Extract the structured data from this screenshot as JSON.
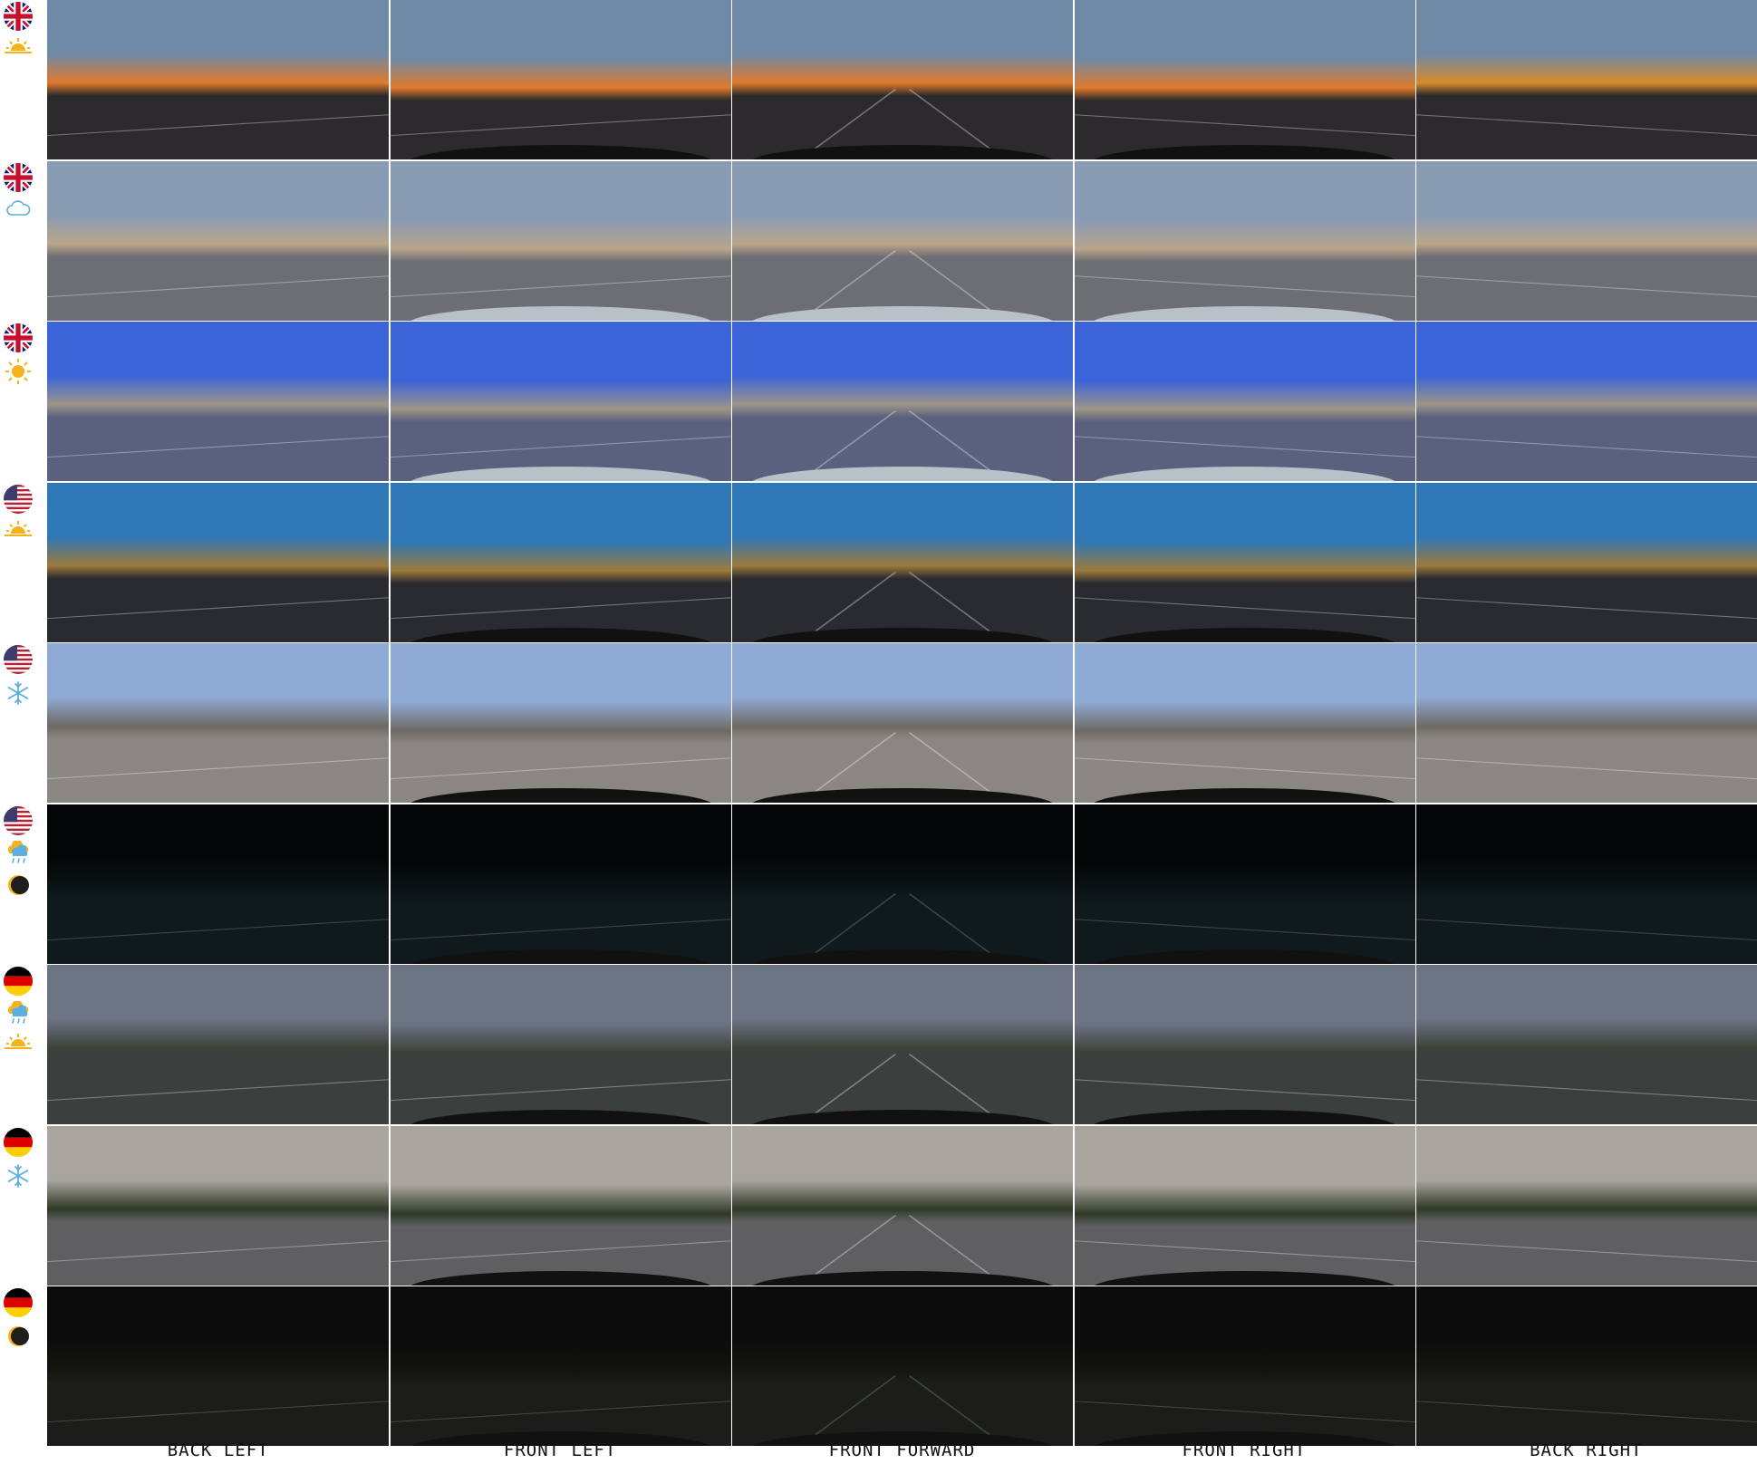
{
  "columns": [
    "BACK LEFT",
    "FRONT LEFT",
    "FRONT FORWARD",
    "FRONT RIGHT",
    "BACK RIGHT"
  ],
  "rows": [
    {
      "country": "uk",
      "conditions": [
        "sunrise-icon"
      ],
      "colors": {
        "sky": "#6e8aa6",
        "mid": "#e07a2c",
        "ground": "#2c2a2c"
      }
    },
    {
      "country": "uk",
      "conditions": [
        "cloud-icon"
      ],
      "colors": {
        "sky": "#8a9bb4",
        "mid": "#b9a58a",
        "ground": "#6d6e74"
      }
    },
    {
      "country": "uk",
      "conditions": [
        "sun-icon"
      ],
      "colors": {
        "sky": "#3a64d8",
        "mid": "#9d9587",
        "ground": "#5a607e"
      }
    },
    {
      "country": "us",
      "conditions": [
        "sunrise-icon"
      ],
      "colors": {
        "sky": "#2f77b7",
        "mid": "#9c7a3c",
        "ground": "#2a2b30"
      }
    },
    {
      "country": "us",
      "conditions": [
        "snowflake-icon"
      ],
      "colors": {
        "sky": "#8faad4",
        "mid": "#6e6a63",
        "ground": "#8a8682"
      }
    },
    {
      "country": "us",
      "conditions": [
        "rain-icon",
        "moon-icon"
      ],
      "colors": {
        "sky": "#050607",
        "mid": "#0b1416",
        "ground": "#101a1d"
      }
    },
    {
      "country": "de",
      "conditions": [
        "rain-icon",
        "sunrise-icon"
      ],
      "colors": {
        "sky": "#6c7383",
        "mid": "#3c4238",
        "ground": "#3b3f3e"
      }
    },
    {
      "country": "de",
      "conditions": [
        "snowflake-icon"
      ],
      "colors": {
        "sky": "#a8a49e",
        "mid": "#2f3a27",
        "ground": "#5f5f62"
      }
    },
    {
      "country": "de",
      "conditions": [
        "moon-icon"
      ],
      "colors": {
        "sky": "#0c0c0c",
        "mid": "#14150f",
        "ground": "#1c1d1a"
      }
    }
  ]
}
